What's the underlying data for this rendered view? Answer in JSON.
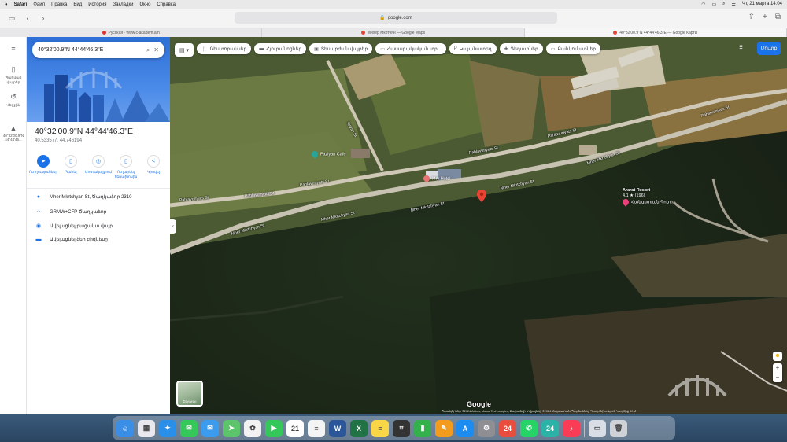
{
  "menubar": {
    "items": [
      "Safari",
      "Файл",
      "Правка",
      "Вид",
      "История",
      "Закладки",
      "Окно",
      "Справка"
    ],
    "clock": "Чт, 21 марта 14:04"
  },
  "browser": {
    "url": "google.com",
    "tabs": [
      {
        "label": "Русская · www.c-academ.am"
      },
      {
        "label": "Михер Мкртчян — Google Maps"
      },
      {
        "label": "40°32'00.9\"N 44°44'46.3\"E — Google Карты"
      }
    ]
  },
  "rail": {
    "items": [
      {
        "icon": "menu-icon",
        "label": ""
      },
      {
        "icon": "bookmark-icon",
        "label": "Պահված վայրեր"
      },
      {
        "icon": "history-icon",
        "label": "Վերջին"
      },
      {
        "icon": "place-icon",
        "label": "40°32'00.9\"N 44°44'46..."
      }
    ]
  },
  "panel": {
    "search_value": "40°32'00.9\"N 44°44'46.3\"E",
    "title": "40°32'00.9\"N 44°44'46.3\"E",
    "subtitle": "40.533577, 44.746194",
    "actions": [
      {
        "label": "Ուղղություններ",
        "icon": "directions-icon"
      },
      {
        "label": "Պահել",
        "icon": "save-icon"
      },
      {
        "label": "Մոտակայքում",
        "icon": "nearby-icon"
      },
      {
        "label": "Ուղարկել հեռախոսին",
        "icon": "phone-icon"
      },
      {
        "label": "Կիսվել",
        "icon": "share-icon"
      }
    ],
    "info": [
      {
        "icon": "pin-icon",
        "text": "Mher Mkrtchyan St, Ծաղկաձոր 2310"
      },
      {
        "icon": "plus-code-icon",
        "text": "GRMW+CFP Ծաղկաձոր"
      },
      {
        "icon": "add-place-icon",
        "text": "Ավելացնել բացակա վայր"
      },
      {
        "icon": "business-icon",
        "text": "Ավելացնել ձեր բիզնեսը"
      }
    ]
  },
  "map": {
    "chips": [
      {
        "icon": "restaurant-icon",
        "label": "Ռեստորաններ"
      },
      {
        "icon": "hotel-icon",
        "label": "Հյուրանոցներ"
      },
      {
        "icon": "attraction-icon",
        "label": "Տեսարժան վայրեր"
      },
      {
        "icon": "transit-icon",
        "label": "Հասարակական տր..."
      },
      {
        "icon": "parking-icon",
        "label": "Կայանատեղ"
      },
      {
        "icon": "pharmacy-icon",
        "label": "Դեղատներ"
      },
      {
        "icon": "atm-icon",
        "label": "Բանկոմատներ"
      }
    ],
    "signin_label": "Մուտք",
    "layers_label": "Շերտեր",
    "road_labels": {
      "mher_1": "Mher Mkrtchyan St",
      "mher_2": "Mher Mkrtchyan St",
      "mher_3": "Mher Mkrtchyan St",
      "mher_4": "Mher Mkrtchyan St",
      "mher_5": "Mher Mkrtchyan St",
      "pahlavuni_1": "Pahlavunyats St",
      "pahlavuni_2": "Pahlavunyats St",
      "pahlavuni_3": "Pahlavunyats St",
      "pahlavuni_4": "Pahlavunyats St",
      "pahlavuni_5": "Pahlavunyats St",
      "side": "Teryan St"
    },
    "pois": {
      "mzhavan": "Mry Hotel",
      "cafe": "Fazlyan Cafe",
      "ararat_name": "Ararat Resort",
      "ararat_rating": "4.1 ★ (196)",
      "ararat_sub": "Հանգստյան Գոտի"
    },
    "google_logo": "Google",
    "attribution": "Պատկերներ ©2024 Airbus, Maxar Technologies, Քարտեզի տվյալներ ©2024   Հայաստան   Պայմաններ   Գաղտնիություն   Կարծիք   50 մ"
  },
  "dock": {
    "apps": [
      {
        "icon": "finder-icon",
        "color": "#3a8ee6",
        "glyph": "☺"
      },
      {
        "icon": "launchpad-icon",
        "color": "#e8e8ee",
        "glyph": "▦"
      },
      {
        "icon": "safari-icon",
        "color": "#2a8fe8",
        "glyph": "✦"
      },
      {
        "icon": "messages-icon",
        "color": "#35c759",
        "glyph": "✉"
      },
      {
        "icon": "mail-icon",
        "color": "#3a9bef",
        "glyph": "✉"
      },
      {
        "icon": "maps-icon",
        "color": "#5cc46a",
        "glyph": "➤"
      },
      {
        "icon": "photos-icon",
        "color": "#f2f2f2",
        "glyph": "✿"
      },
      {
        "icon": "facetime-icon",
        "color": "#34c759",
        "glyph": "▶"
      },
      {
        "icon": "calendar-icon",
        "color": "#ffffff",
        "glyph": "21"
      },
      {
        "icon": "reminders-icon",
        "color": "#f4f4f4",
        "glyph": "≡"
      },
      {
        "icon": "word-icon",
        "color": "#2b579a",
        "glyph": "W"
      },
      {
        "icon": "excel-icon",
        "color": "#217346",
        "glyph": "X"
      },
      {
        "icon": "notes-icon",
        "color": "#f8d648",
        "glyph": "≡"
      },
      {
        "icon": "calculator-icon",
        "color": "#333333",
        "glyph": "⌗"
      },
      {
        "icon": "numbers-icon",
        "color": "#33b14a",
        "glyph": "▮"
      },
      {
        "icon": "pages-icon",
        "color": "#f29b1d",
        "glyph": "✎"
      },
      {
        "icon": "appstore-icon",
        "color": "#1d8cf0",
        "glyph": "A"
      },
      {
        "icon": "settings-icon",
        "color": "#8e8e93",
        "glyph": "⚙"
      },
      {
        "icon": "news24-icon",
        "color": "#e84d3d",
        "glyph": "24"
      },
      {
        "icon": "whatsapp-icon",
        "color": "#25d366",
        "glyph": "✆"
      },
      {
        "icon": "app24-icon",
        "color": "#2ab3a6",
        "glyph": "24"
      },
      {
        "icon": "music-icon",
        "color": "#fa3c56",
        "glyph": "♪"
      },
      {
        "icon": "preview-icon",
        "color": "#d8dde6",
        "glyph": "▭"
      },
      {
        "icon": "trash-icon",
        "color": "#cfd3d8",
        "glyph": "🗑"
      }
    ]
  }
}
